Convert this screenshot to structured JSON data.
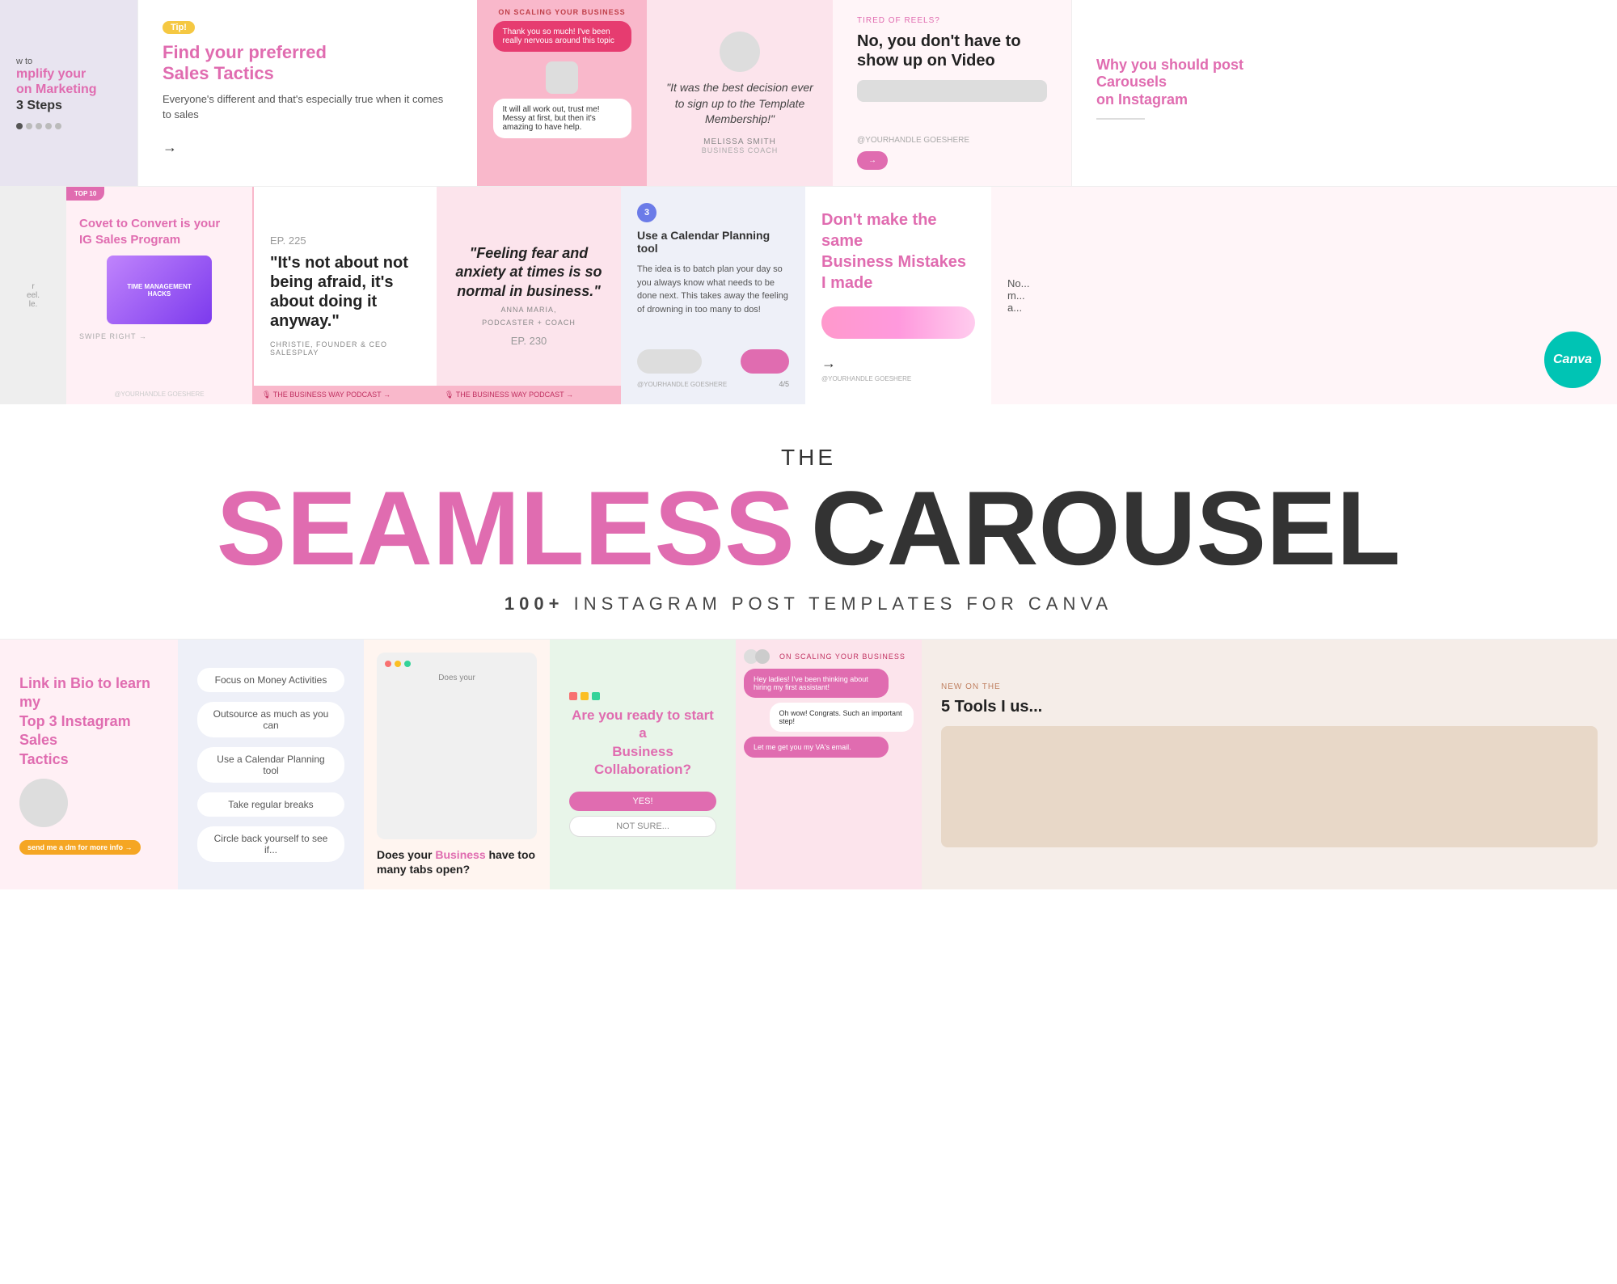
{
  "topRow": {
    "card1": {
      "line1": "w to",
      "line2": "mplify your",
      "accent": "on Marketing",
      "line3": "3 Steps"
    },
    "card2": {
      "tip": "Tip!",
      "heading1": "Find your preferred",
      "headingAccent": "Sales Tactics",
      "body": "Everyone's different and that's especially true when it comes to sales"
    },
    "card3": {
      "header": "ON SCALING YOUR BUSINESS",
      "msg1": "Thank you so much! I've been really nervous around this topic",
      "msg2": "It will all work out, trust me! Messy at first, but then it's amazing to have help."
    },
    "card4": {
      "quote": "\"It was the best decision ever to sign up to the Template Membership!\"",
      "author": "MELISSA SMITH",
      "authorTitle": "BUSINESS COACH"
    },
    "card5": {
      "tired": "TIRED OF REELS?",
      "heading": "No, you don't have to show up on Video",
      "handle": "@YOURHANDLE GOESHERE",
      "btn": "→"
    },
    "card6": {
      "heading1": "Why you should post",
      "headingAccent": "Carousels",
      "heading2": "on Instagram"
    }
  },
  "midRow": {
    "card1": {
      "topBadge": "TOP 10",
      "heading1": "Covet to Convert",
      "heading2": "is your",
      "heading3": "IG Sales Program",
      "deviceLabel": "TIME MANAGEMENT\nHACKS",
      "swipe": "SWIPE RIGHT →",
      "handle": "@YOURHANDLE GOESHERE"
    },
    "card2": {
      "ep": "EP. 225",
      "quote": "\"It's not about not being afraid, it's about doing it anyway.\"",
      "attribution": "CHRISTIE, FOUNDER & CEO\nSALESPLAY",
      "footer": "🎙 THE BUSINESS WAY PODCAST →"
    },
    "card3": {
      "quote": "\"Feeling fear and anxiety at times is so normal in business.\"",
      "author": "ANNA MARIA,",
      "authorTitle": "PODCASTER + COACH",
      "ep": "EP. 230",
      "footer": "🎙 THE BUSINESS WAY PODCAST →"
    },
    "card4": {
      "step": "3",
      "title": "Use a Calendar Planning tool",
      "body": "The idea is to batch plan your day so you always know what needs to be done next. This takes away the feeling of drowning in too many to dos!",
      "handle": "@YOURHANDLE GOESHERE",
      "page": "4/5"
    },
    "card5": {
      "heading1": "Don't make the same",
      "headingAccent": "Business Mistakes",
      "heading2": "I made",
      "arrow": "→"
    },
    "canva": "Canva"
  },
  "titleSection": {
    "the": "THE",
    "seamless": "SEAMLESS",
    "carousel": "CAROUSEL",
    "subBold": "100+",
    "sub": "INSTAGRAM POST TEMPLATES FOR CANVA"
  },
  "bottomRow": {
    "card1": {
      "heading1": "Link in Bio to learn my",
      "headingAccent": "Top 3 Instagram Sales",
      "heading2": "Tactics",
      "badge": "send me a dm for more info →"
    },
    "card2": {
      "items": [
        "Focus on Money Activities",
        "Outsource as much as you can",
        "Use a Calendar Planning tool",
        "Take regular breaks",
        "Circle back yourself to see if..."
      ]
    },
    "card3": {
      "msg1": "Does your Business have too many tabs open?",
      "titleAccent": "Business",
      "title": "Does your Business have too many tabs open?"
    },
    "card4": {
      "heading": "Are you ready to start a",
      "headingAccent": "Business Collaboration?",
      "btnYes": "YES!",
      "btnNo": "NOT SURE..."
    },
    "card5": {
      "header": "ON SCALING YOUR BUSINESS",
      "msg1": "Hey ladies! I've been thinking about hiring my first assistant!",
      "msg2": "Oh wow! Congrats. Such an important step!",
      "msg3": "Let me get you my VA's email."
    },
    "card6": {
      "newOn": "NEW ON THE",
      "heading": "5 Tools I us..."
    }
  }
}
